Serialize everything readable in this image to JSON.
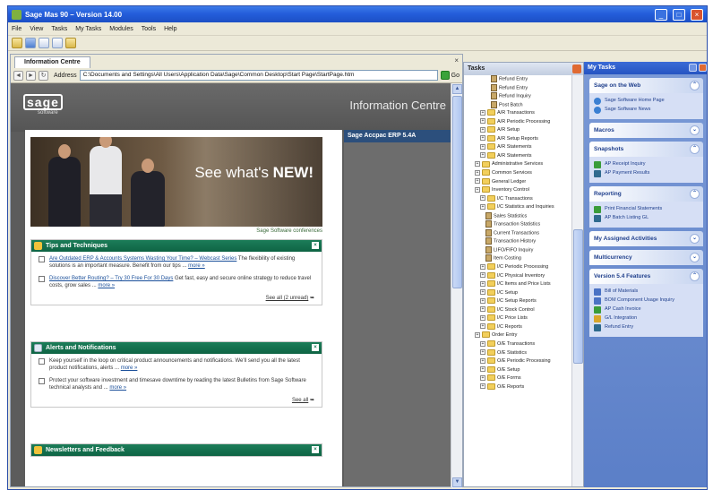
{
  "window": {
    "title": "Sage Mas 90 – Version 14.00",
    "controls": [
      "_",
      "□",
      "×"
    ]
  },
  "menu": [
    "File",
    "View",
    "Tasks",
    "My Tasks",
    "Modules",
    "Tools",
    "Help"
  ],
  "info_centre": {
    "tab_label": "Information Centre",
    "close_glyph": "×",
    "address_label": "Address",
    "address_value": "C:\\Documents and Settings\\All Users\\Application Data\\Sage\\Common Desktop\\Start Page\\StartPage.htm",
    "go_label": "Go",
    "logo_text": "sage",
    "logo_sub": "software",
    "title": "Information Centre",
    "version_badge": "Sage Accpac ERP 5.4A",
    "banner_text_prefix": "See what's ",
    "banner_text_bold": "NEW!",
    "banner_link": "Sage Software conferences",
    "panels": [
      {
        "title": "Tips and Techniques",
        "items": [
          {
            "link": "Are Outdated ERP & Accounts Systems Wasting Your Time? – Webcast Series",
            "text": " The flexibility of existing solutions is an important measure. Benefit from our tips ...",
            "more": "more »"
          },
          {
            "link": "Discover Better Routing? – Try 30 Free For 30 Days",
            "text": " Get fast, easy and secure online strategy to reduce travel costs, grow sales ...",
            "more": "more »"
          }
        ],
        "footer": "See all (2 unread)"
      },
      {
        "title": "Alerts and Notifications",
        "items": [
          {
            "link": "",
            "text": "Keep yourself in the loop on critical product announcements and notifications. We'll send you all the latest product notifications, alerts ...",
            "more": "more »"
          },
          {
            "link": "",
            "text": "Protect your software investment and timesave downtime by reading the latest Bulletins from Sage Software technical analysts and ...",
            "more": "more »"
          }
        ],
        "footer": "See all"
      },
      {
        "title": "Newsletters and Feedback",
        "items": [],
        "footer": ""
      }
    ]
  },
  "tasks": {
    "title": "Tasks",
    "rows": [
      {
        "indent": 4,
        "type": "task",
        "label": "Refund Entry"
      },
      {
        "indent": 4,
        "type": "task",
        "label": "Refund Entry"
      },
      {
        "indent": 4,
        "type": "task",
        "label": "Refund Inquiry"
      },
      {
        "indent": 4,
        "type": "task",
        "label": "Post Batch"
      },
      {
        "indent": 2,
        "type": "folder",
        "label": "A/R Transactions"
      },
      {
        "indent": 2,
        "type": "folder",
        "label": "A/R Periodic Processing"
      },
      {
        "indent": 2,
        "type": "folder",
        "label": "A/R Setup"
      },
      {
        "indent": 2,
        "type": "folder",
        "label": "A/R Setup Reports"
      },
      {
        "indent": 2,
        "type": "folder",
        "label": "A/R Statements"
      },
      {
        "indent": 2,
        "type": "folder",
        "label": "A/R Statements"
      },
      {
        "indent": 1,
        "type": "folder",
        "label": "Administrative Services"
      },
      {
        "indent": 1,
        "type": "folder",
        "label": "Common Services"
      },
      {
        "indent": 1,
        "type": "folder",
        "label": "General Ledger"
      },
      {
        "indent": 1,
        "type": "folder",
        "label": "Inventory Control"
      },
      {
        "indent": 2,
        "type": "folder",
        "label": "I/C Transactions"
      },
      {
        "indent": 2,
        "type": "folder",
        "label": "I/C Statistics and Inquiries"
      },
      {
        "indent": 3,
        "type": "task",
        "label": "Sales Statistics"
      },
      {
        "indent": 3,
        "type": "task",
        "label": "Transaction Statistics"
      },
      {
        "indent": 3,
        "type": "task",
        "label": "Current Transactions"
      },
      {
        "indent": 3,
        "type": "task",
        "label": "Transaction History"
      },
      {
        "indent": 3,
        "type": "task",
        "label": "LIFO/FIFO Inquiry"
      },
      {
        "indent": 3,
        "type": "task",
        "label": "Item Costing"
      },
      {
        "indent": 2,
        "type": "folder",
        "label": "I/C Periodic Processing"
      },
      {
        "indent": 2,
        "type": "folder",
        "label": "I/C Physical Inventory"
      },
      {
        "indent": 2,
        "type": "folder",
        "label": "I/C Items and Price Lists"
      },
      {
        "indent": 2,
        "type": "folder",
        "label": "I/C Setup"
      },
      {
        "indent": 2,
        "type": "folder",
        "label": "I/C Setup Reports"
      },
      {
        "indent": 2,
        "type": "folder",
        "label": "I/C Stock Control"
      },
      {
        "indent": 2,
        "type": "folder",
        "label": "I/C Price Lists"
      },
      {
        "indent": 2,
        "type": "folder",
        "label": "I/C Reports"
      },
      {
        "indent": 1,
        "type": "folder",
        "label": "Order Entry"
      },
      {
        "indent": 2,
        "type": "folder",
        "label": "O/E Transactions"
      },
      {
        "indent": 2,
        "type": "folder",
        "label": "O/E Statistics"
      },
      {
        "indent": 2,
        "type": "folder",
        "label": "O/E Periodic Processing"
      },
      {
        "indent": 2,
        "type": "folder",
        "label": "O/E Setup"
      },
      {
        "indent": 2,
        "type": "folder",
        "label": "O/E Forms"
      },
      {
        "indent": 2,
        "type": "folder",
        "label": "O/E Reports"
      }
    ]
  },
  "my_tasks": {
    "title": "My Tasks",
    "groups": [
      {
        "title": "Sage on the Web",
        "items": [
          {
            "icon": "globe",
            "label": "Sage Software Home Page"
          },
          {
            "icon": "globe",
            "label": "Sage Software News"
          }
        ]
      },
      {
        "title": "Macros",
        "items": []
      },
      {
        "title": "Snapshots",
        "items": [
          {
            "icon": "green",
            "label": "AP Receipt Inquiry"
          },
          {
            "icon": "report",
            "label": "AP Payment Results"
          }
        ]
      },
      {
        "title": "Reporting",
        "items": [
          {
            "icon": "green",
            "label": "Print Financial Statements"
          },
          {
            "icon": "report",
            "label": "AP Batch Listing GL"
          }
        ]
      },
      {
        "title": "My Assigned Activities",
        "items": []
      },
      {
        "title": "Multicurrency",
        "items": []
      },
      {
        "title": "Version 5.4 Features",
        "items": [
          {
            "icon": "blue",
            "label": "Bill of Materials"
          },
          {
            "icon": "blue",
            "label": "BOM Component Usage Inquiry"
          },
          {
            "icon": "green",
            "label": "AP Cash Invoice"
          },
          {
            "icon": "yellow",
            "label": "G/L Integration"
          },
          {
            "icon": "report",
            "label": "Refund Entry"
          }
        ]
      }
    ]
  }
}
